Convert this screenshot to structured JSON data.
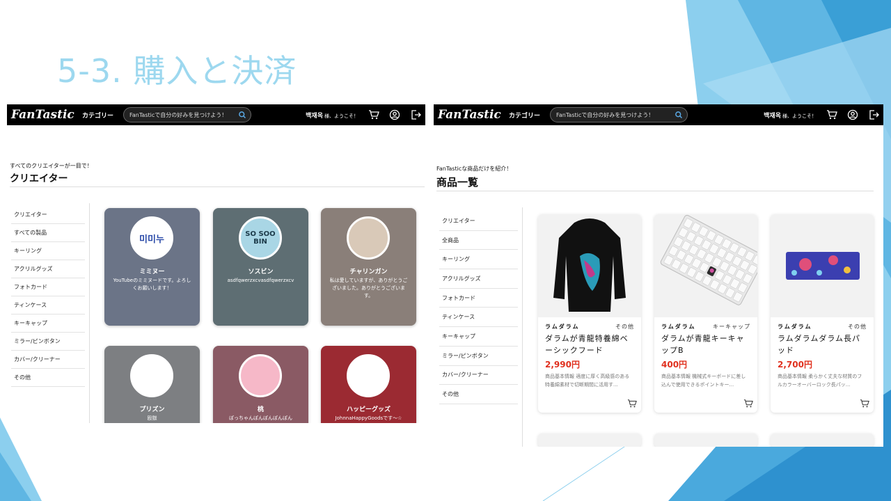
{
  "slide": {
    "title": "5-3. 購入と決済"
  },
  "left": {
    "topbar": {
      "logo": "FanTastic",
      "category": "カテゴリー",
      "search_placeholder": "FanTasticで自分の好みを見つけよう！",
      "user_name": "백재옥",
      "user_suffix": "様、ようこそ！"
    },
    "subheading": "すべてのクリエイターが一目で！",
    "heading": "クリエイター",
    "sidebar": [
      "クリエイター",
      "すべての製品",
      "キーリング",
      "アクリルグッズ",
      "フォトカード",
      "ティンケース",
      "キーキャップ",
      "ミラー/ピンボタン",
      "カバー/クリーナー",
      "その他"
    ],
    "creators": [
      {
        "name": "ミミヌー",
        "desc": "YouTubeのミミヌードです。よろしくお願いします！",
        "avatar_text": "미미누",
        "bg": "#6b7487",
        "avatar_bg": "#ffffff"
      },
      {
        "name": "ソスビン",
        "desc": "asdfqwerzxcvasdfqwerzxcv",
        "avatar_text": "SO SOO BIN",
        "bg": "#5e6e73",
        "avatar_bg": "#a9d6e5"
      },
      {
        "name": "チャリンガン",
        "desc": "私は愛していますが、ありがとうございました。ありがとうございます。",
        "avatar_text": "",
        "bg": "#8a7f79",
        "avatar_bg": "#d9c9b8"
      },
      {
        "name": "プリズン",
        "desc": "殴獄",
        "avatar_text": "",
        "bg": "#7d7f82",
        "avatar_bg": "#ffffff"
      },
      {
        "name": "桃",
        "desc": "ぽっちゃんぽんぽんぽんぽん",
        "avatar_text": "",
        "bg": "#8a5a64",
        "avatar_bg": "#f6b8c8"
      },
      {
        "name": "ハッピーグッズ",
        "desc": "JohnnaHappyGoodsです～☆",
        "avatar_text": "",
        "bg": "#9b2a32",
        "avatar_bg": "#ffffff"
      }
    ]
  },
  "right": {
    "topbar": {
      "logo": "FanTastic",
      "category": "カテゴリー",
      "search_placeholder": "FanTasticで自分の好みを見つけよう！",
      "user_name": "백재옥",
      "user_suffix": "様、ようこそ！"
    },
    "subheading": "FanTasticな商品だけを紹介！",
    "heading": "商品一覧",
    "sidebar": [
      "クリエイター",
      "全商品",
      "キーリング",
      "アクリルグッズ",
      "フォトカード",
      "ティンケース",
      "キーキャップ",
      "ミラー/ピンボタン",
      "カバー/クリーナー",
      "その他"
    ],
    "products": [
      {
        "creator": "ラムダラム",
        "category": "その他",
        "name": "ダラムが青龍特養綿ベーシックフード",
        "price": "2,990円",
        "desc": "商品基本情報 適度に厚く高級感のある特養綿素材で切断期間に活用す...",
        "image": "hoodie"
      },
      {
        "creator": "ラムダラム",
        "category": "キーキャップ",
        "name": "ダラムが青龍キーキャップB",
        "price": "400円",
        "desc": "商品基本情報 機械式キーボードに差し込んで使用できるポイントキー...",
        "image": "keyboard"
      },
      {
        "creator": "ラムダラム",
        "category": "その他",
        "name": "ラムダラムダラム長パッド",
        "price": "2,700円",
        "desc": "商品基本情報 柔らかく丈夫な材質のフルカラーオーバーロック長パッ...",
        "image": "pad"
      }
    ]
  },
  "colors": {
    "title": "#9dd8ef",
    "accent_blue": "#4aa9dd",
    "price": "#e0301e",
    "topbar": "#000000"
  }
}
